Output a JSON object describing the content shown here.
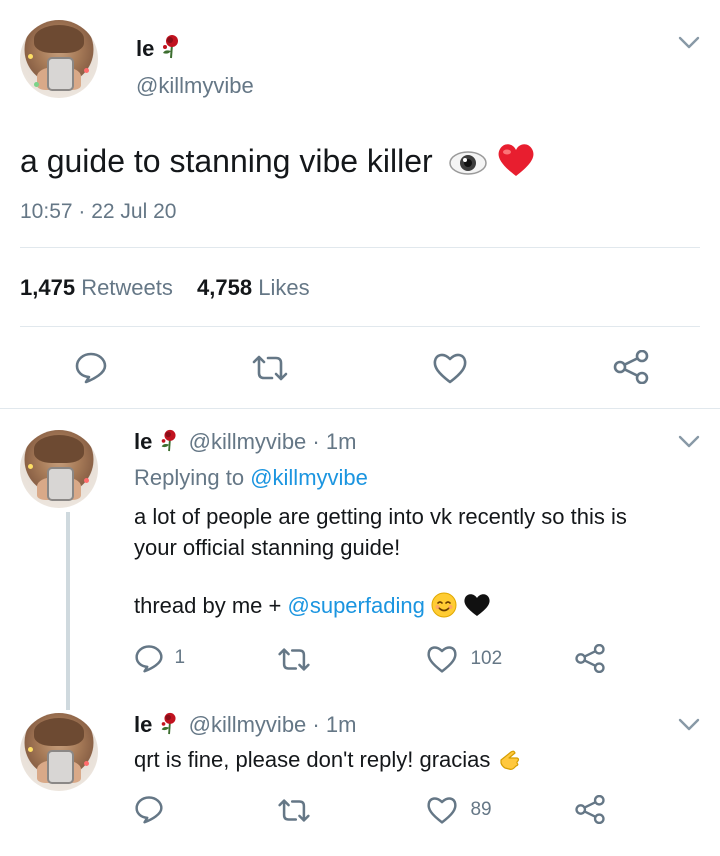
{
  "main_tweet": {
    "display_name": "le",
    "handle": "@killmyvibe",
    "text": "a guide to stanning vibe killer",
    "timestamp": "10:57 · 22 Jul 20",
    "retweets_count": "1,475",
    "retweets_label": "Retweets",
    "likes_count": "4,758",
    "likes_label": "Likes"
  },
  "replies": [
    {
      "display_name": "le",
      "handle_time": "@killmyvibe · 1m",
      "replying_prefix": "Replying to",
      "replying_to": "@killmyvibe",
      "line1": "a lot of people are getting into vk recently so this is",
      "line2": "your official stanning guide!",
      "line3_prefix": "thread by me +",
      "line3_mention": "@superfading",
      "reply_count": "1",
      "like_count": "102"
    },
    {
      "display_name": "le",
      "handle_time": "@killmyvibe · 1m",
      "text": "qrt is fine, please don't reply! gracias",
      "like_count": "89"
    }
  ],
  "colors": {
    "text": "#14171a",
    "muted": "#657786",
    "link": "#1b95e0",
    "icon": "#657786",
    "divider": "#e1e8ed",
    "heart": "#e0245e"
  }
}
